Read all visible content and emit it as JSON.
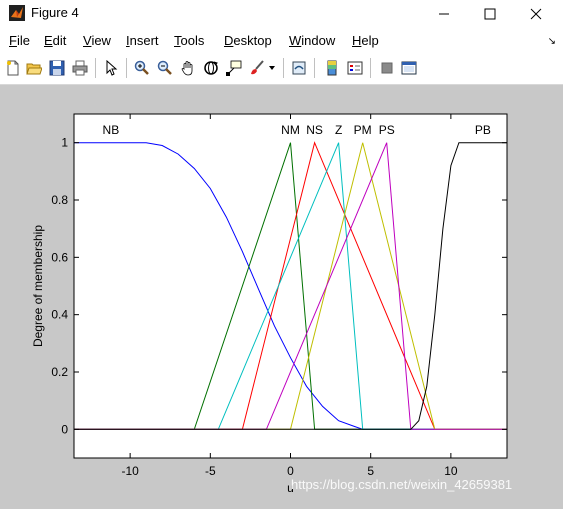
{
  "window": {
    "title": "Figure 4"
  },
  "menu": [
    {
      "key": "F",
      "rest": "ile"
    },
    {
      "key": "E",
      "rest": "dit"
    },
    {
      "key": "V",
      "rest": "iew"
    },
    {
      "key": "I",
      "rest": "nsert"
    },
    {
      "key": "T",
      "rest": "ools"
    },
    {
      "key": "D",
      "rest": "esktop"
    },
    {
      "key": "W",
      "rest": "indow"
    },
    {
      "key": "H",
      "rest": "elp"
    }
  ],
  "toolbar_icons": [
    "new-figure-icon",
    "open-file-icon",
    "save-icon",
    "print-icon",
    "select-arrow-icon",
    "zoom-in-icon",
    "zoom-out-icon",
    "pan-hand-icon",
    "rotate-3d-icon",
    "data-cursor-icon",
    "brush-icon",
    "link-plot-icon",
    "colorbar-icon",
    "legend-icon",
    "hide-plot-tools-icon",
    "show-plot-tools-icon"
  ],
  "watermark": "https://blog.csdn.net/weixin_42659381",
  "chart_data": {
    "type": "line",
    "xlabel": "u",
    "ylabel": "Degree of membership",
    "xlim": [
      -13.5,
      13.5
    ],
    "ylim": [
      -0.1,
      1.1
    ],
    "xticks": [
      -10,
      -5,
      0,
      5,
      10
    ],
    "xtick_labels": [
      "-10",
      "-5",
      "0",
      "5",
      "10"
    ],
    "yticks": [
      0,
      0.2,
      0.4,
      0.6,
      0.8,
      1
    ],
    "ytick_labels": [
      "0",
      "0.2",
      "0.4",
      "0.6",
      "0.8",
      "1"
    ],
    "grid": false,
    "series": [
      {
        "name": "NB",
        "color": "#0000ff",
        "label_x": -11.2,
        "x": [
          -13.5,
          -9,
          -8,
          -7,
          -6,
          -5,
          -4,
          -3,
          -2,
          -1,
          0,
          1,
          2,
          3,
          4,
          4.5,
          13.5
        ],
        "y": [
          1,
          1,
          0.99,
          0.96,
          0.91,
          0.84,
          0.74,
          0.62,
          0.49,
          0.36,
          0.25,
          0.15,
          0.08,
          0.03,
          0.01,
          0,
          0
        ]
      },
      {
        "name": "NM",
        "color": "#007000",
        "label_x": 0,
        "x": [
          -13.5,
          -6,
          0,
          1.5,
          13.5
        ],
        "y": [
          0,
          0,
          1,
          0,
          0
        ]
      },
      {
        "name": "NS",
        "color": "#ff0000",
        "label_x": 1.5,
        "x": [
          -13.5,
          -3,
          1.5,
          9,
          13.5
        ],
        "y": [
          0,
          0,
          1,
          0,
          0
        ]
      },
      {
        "name": "Z",
        "color": "#00bfbf",
        "label_x": 3,
        "x": [
          -13.5,
          -4.5,
          3,
          4.5,
          13.5
        ],
        "y": [
          0,
          0,
          1,
          0,
          0
        ]
      },
      {
        "name": "PM",
        "color": "#bfbf00",
        "label_x": 4.5,
        "x": [
          -13.5,
          0,
          4.5,
          9,
          13.5
        ],
        "y": [
          0,
          0,
          1,
          0,
          0
        ]
      },
      {
        "name": "PS",
        "color": "#bf00bf",
        "label_x": 6,
        "x": [
          -13.5,
          -1.5,
          6,
          7.5,
          13.5
        ],
        "y": [
          0,
          0,
          1,
          0,
          0
        ]
      },
      {
        "name": "PB",
        "color": "#000000",
        "label_x": 12,
        "x": [
          -13.5,
          7.5,
          8,
          8.5,
          9,
          9.5,
          10,
          10.5,
          13.5
        ],
        "y": [
          0,
          0,
          0.03,
          0.15,
          0.4,
          0.7,
          0.92,
          1,
          1
        ]
      }
    ]
  }
}
